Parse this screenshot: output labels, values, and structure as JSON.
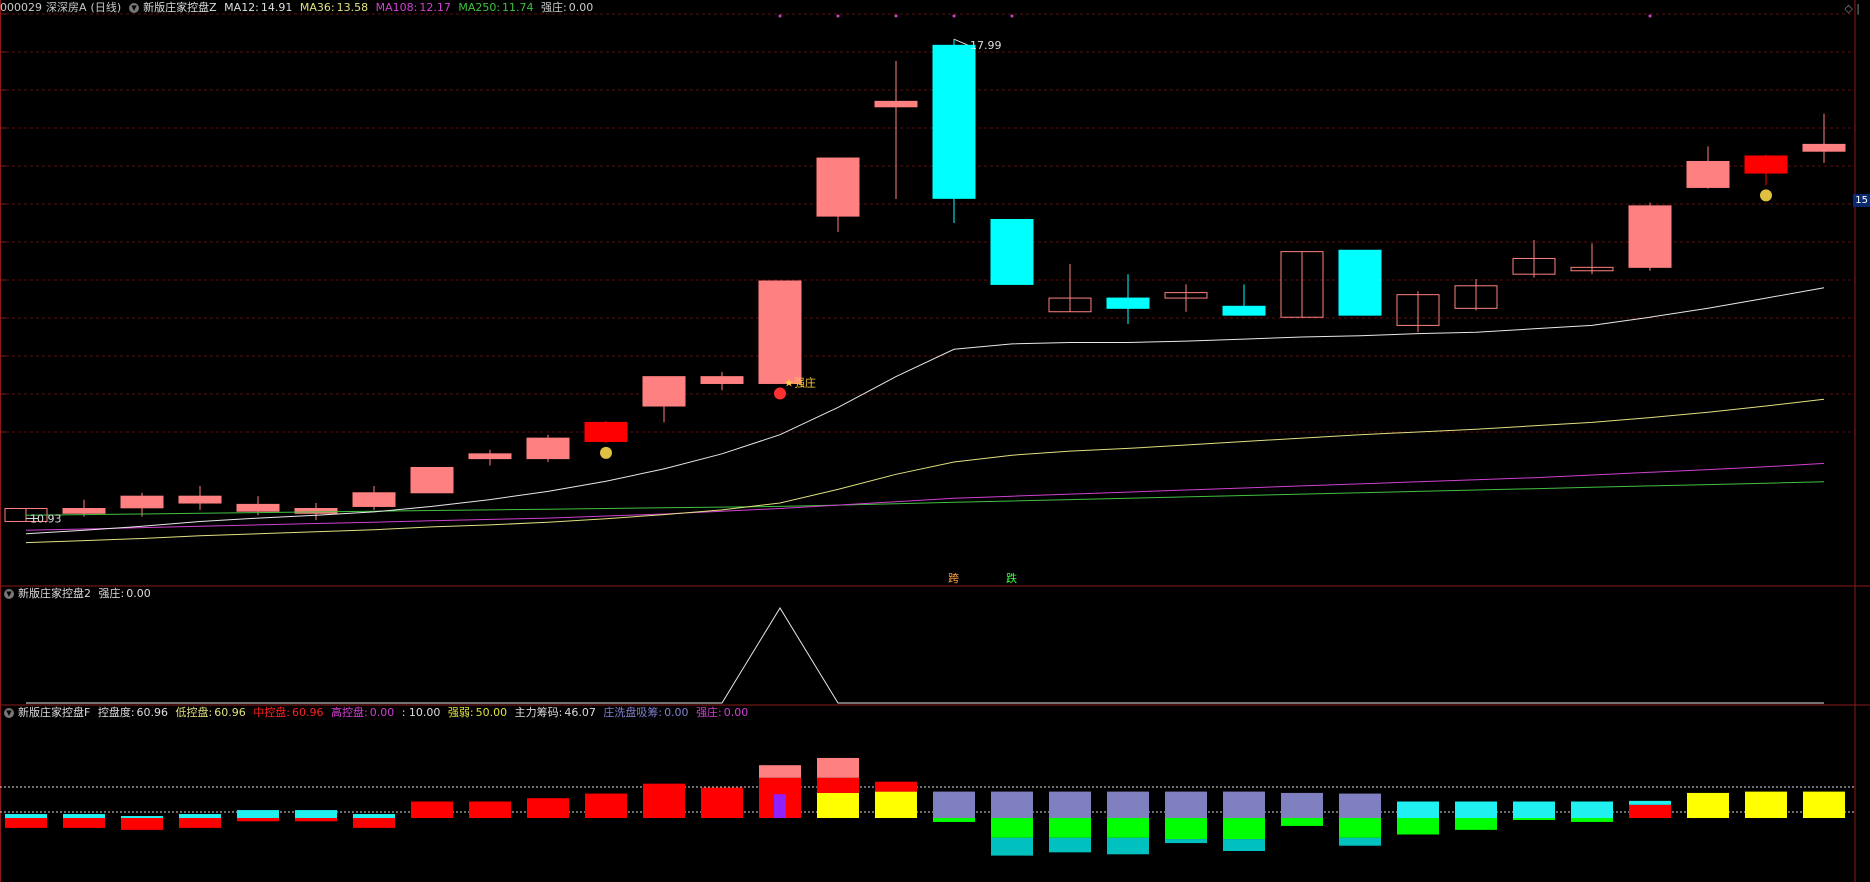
{
  "main_header": {
    "code": "000029",
    "name": "深深房A",
    "period": "(日线)",
    "indicator": "新版庄家控盘Z",
    "ma12_label": "MA12:",
    "ma12": "14.91",
    "ma36_label": "MA36:",
    "ma36": "13.58",
    "ma108_label": "MA108:",
    "ma108": "12.17",
    "ma250_label": "MA250:",
    "ma250": "11.74",
    "qz_label": "强庄:",
    "qz": "0.00"
  },
  "sub1_header": {
    "indicator": "新版庄家控盘2",
    "qz_label": "强庄:",
    "qz": "0.00"
  },
  "sub2_header": {
    "indicator": "新版庄家控盘F",
    "kpd_label": "控盘度:",
    "kpd": "60.96",
    "dkp_label": "低控盘:",
    "dkp": "60.96",
    "zkp_label": "中控盘:",
    "zkp": "60.96",
    "gkp_label": "高控盘:",
    "gkp": "0.00",
    "sep": ": 10.00",
    "qr_label": "强弱:",
    "qr": "50.00",
    "zlcm_label": "主力筹码:",
    "zlcm": "46.07",
    "zxp_label": "庄洗盘吸筹:",
    "zxp": "0.00",
    "qz_label": "强庄:",
    "qz": "0.00"
  },
  "right_price_tag": "15",
  "corner_icon": "diamond-icon",
  "colors": {
    "up": "#ff8080",
    "up_strong": "#ff0000",
    "down": "#00ffff",
    "ma12": "#e8e8e8",
    "ma36": "#e0e080",
    "ma108": "#d040d0",
    "ma250": "#40c040",
    "yellow": "#ffff00",
    "purple": "#8080c0",
    "green": "#00ff00",
    "teal": "#00c0c0"
  },
  "chart_data": {
    "type": "candlestick",
    "price_range": [
      10.0,
      18.3
    ],
    "high_annotation": "17.99",
    "low_annotation": "10.93",
    "markers": [
      {
        "index": 13,
        "text": "强庄"
      },
      {
        "index": 16,
        "text": "跨"
      },
      {
        "index": 17,
        "text": "跌"
      }
    ],
    "candles": [
      {
        "o": 10.93,
        "h": 11.12,
        "l": 10.93,
        "c": 11.12,
        "s": "hollow"
      },
      {
        "o": 11.05,
        "h": 11.25,
        "l": 11.0,
        "c": 11.12,
        "s": "up"
      },
      {
        "o": 11.13,
        "h": 11.35,
        "l": 11.0,
        "c": 11.3,
        "s": "up"
      },
      {
        "o": 11.2,
        "h": 11.45,
        "l": 11.1,
        "c": 11.3,
        "s": "up"
      },
      {
        "o": 11.18,
        "h": 11.3,
        "l": 11.02,
        "c": 11.08,
        "s": "up"
      },
      {
        "o": 11.05,
        "h": 11.2,
        "l": 10.95,
        "c": 11.12,
        "s": "up"
      },
      {
        "o": 11.15,
        "h": 11.45,
        "l": 11.1,
        "c": 11.35,
        "s": "up"
      },
      {
        "o": 11.35,
        "h": 11.72,
        "l": 11.35,
        "c": 11.72,
        "s": "up"
      },
      {
        "o": 11.85,
        "h": 11.98,
        "l": 11.75,
        "c": 11.92,
        "s": "up"
      },
      {
        "o": 11.85,
        "h": 12.2,
        "l": 11.8,
        "c": 12.15,
        "s": "up"
      },
      {
        "o": 12.1,
        "h": 12.4,
        "l": 12.08,
        "c": 12.38,
        "s": "strong"
      },
      {
        "o": 12.62,
        "h": 13.05,
        "l": 12.38,
        "c": 13.05,
        "s": "up"
      },
      {
        "o": 12.95,
        "h": 13.12,
        "l": 12.85,
        "c": 13.05,
        "s": "up"
      },
      {
        "o": 12.95,
        "h": 14.45,
        "l": 12.95,
        "c": 14.45,
        "s": "up"
      },
      {
        "o": 15.4,
        "h": 16.25,
        "l": 15.17,
        "c": 16.25,
        "s": "up"
      },
      {
        "o": 17.0,
        "h": 17.67,
        "l": 15.65,
        "c": 17.08,
        "s": "up"
      },
      {
        "o": 17.9,
        "h": 17.99,
        "l": 15.3,
        "c": 15.66,
        "s": "down"
      },
      {
        "o": 15.35,
        "h": 15.35,
        "l": 14.4,
        "c": 14.4,
        "s": "down"
      },
      {
        "o": 14.2,
        "h": 14.7,
        "l": 14.0,
        "c": 14.0,
        "s": "hollow"
      },
      {
        "o": 14.2,
        "h": 14.55,
        "l": 13.82,
        "c": 14.05,
        "s": "down"
      },
      {
        "o": 14.2,
        "h": 14.4,
        "l": 14.0,
        "c": 14.28,
        "s": "hollow"
      },
      {
        "o": 14.08,
        "h": 14.4,
        "l": 13.95,
        "c": 13.95,
        "s": "down"
      },
      {
        "o": 13.92,
        "h": 14.88,
        "l": 13.92,
        "c": 14.88,
        "s": "hollow"
      },
      {
        "o": 14.9,
        "h": 14.9,
        "l": 13.95,
        "c": 13.95,
        "s": "down"
      },
      {
        "o": 13.8,
        "h": 14.3,
        "l": 13.7,
        "c": 14.25,
        "s": "hollow"
      },
      {
        "o": 14.05,
        "h": 14.48,
        "l": 14.02,
        "c": 14.38,
        "s": "hollow"
      },
      {
        "o": 14.55,
        "h": 15.05,
        "l": 14.5,
        "c": 14.78,
        "s": "hollow"
      },
      {
        "o": 14.6,
        "h": 15.0,
        "l": 14.55,
        "c": 14.65,
        "s": "hollow"
      },
      {
        "o": 14.65,
        "h": 15.6,
        "l": 14.6,
        "c": 15.55,
        "s": "up"
      },
      {
        "o": 15.82,
        "h": 16.42,
        "l": 15.8,
        "c": 16.2,
        "s": "up"
      },
      {
        "o": 16.03,
        "h": 16.3,
        "l": 15.85,
        "c": 16.28,
        "s": "strong"
      },
      {
        "o": 16.35,
        "h": 16.9,
        "l": 16.18,
        "c": 16.45,
        "s": "up"
      }
    ],
    "ma12": [
      10.75,
      10.8,
      10.86,
      10.93,
      10.98,
      11.02,
      11.07,
      11.15,
      11.25,
      11.37,
      11.52,
      11.7,
      11.92,
      12.2,
      12.6,
      13.05,
      13.45,
      13.53,
      13.55,
      13.55,
      13.57,
      13.6,
      13.63,
      13.65,
      13.68,
      13.7,
      13.75,
      13.8,
      13.92,
      14.05,
      14.2,
      14.35
    ],
    "ma36": [
      10.62,
      10.65,
      10.68,
      10.72,
      10.75,
      10.78,
      10.81,
      10.85,
      10.88,
      10.92,
      10.97,
      11.03,
      11.1,
      11.2,
      11.4,
      11.62,
      11.8,
      11.9,
      11.96,
      12.0,
      12.05,
      12.1,
      12.15,
      12.2,
      12.24,
      12.28,
      12.33,
      12.38,
      12.45,
      12.53,
      12.62,
      12.72
    ],
    "ma108": [
      10.8,
      10.82,
      10.84,
      10.86,
      10.88,
      10.9,
      10.92,
      10.94,
      10.96,
      10.98,
      11.01,
      11.04,
      11.08,
      11.12,
      11.17,
      11.22,
      11.27,
      11.3,
      11.33,
      11.36,
      11.39,
      11.42,
      11.45,
      11.48,
      11.51,
      11.54,
      11.57,
      11.61,
      11.65,
      11.69,
      11.73,
      11.78
    ],
    "ma250": [
      11.02,
      11.03,
      11.04,
      11.05,
      11.06,
      11.07,
      11.08,
      11.09,
      11.1,
      11.11,
      11.12,
      11.13,
      11.14,
      11.15,
      11.17,
      11.19,
      11.21,
      11.23,
      11.25,
      11.27,
      11.29,
      11.31,
      11.33,
      11.35,
      11.37,
      11.39,
      11.41,
      11.43,
      11.45,
      11.47,
      11.49,
      11.51
    ],
    "sub1_line": [
      0,
      0,
      0,
      0,
      0,
      0,
      0,
      0,
      0,
      0,
      0,
      0,
      0,
      100,
      0,
      0,
      0,
      0,
      0,
      0,
      0,
      0,
      0,
      0,
      0,
      0,
      0,
      0,
      0,
      0,
      0,
      0
    ],
    "sub2_bars": [
      [
        {
          "b": -15,
          "t": 0,
          "c": "red"
        },
        {
          "b": 0,
          "t": 6,
          "c": "cyan"
        }
      ],
      [
        {
          "b": -15,
          "t": 0,
          "c": "red"
        },
        {
          "b": 0,
          "t": 6,
          "c": "cyan"
        }
      ],
      [
        {
          "b": -18,
          "t": 0,
          "c": "red"
        },
        {
          "b": 0,
          "t": 3,
          "c": "cyan"
        }
      ],
      [
        {
          "b": -15,
          "t": 0,
          "c": "red"
        },
        {
          "b": 0,
          "t": 6,
          "c": "cyan"
        }
      ],
      [
        {
          "b": -5,
          "t": 0,
          "c": "red"
        },
        {
          "b": 0,
          "t": 12,
          "c": "cyan"
        }
      ],
      [
        {
          "b": -5,
          "t": 0,
          "c": "red"
        },
        {
          "b": 0,
          "t": 12,
          "c": "cyan"
        }
      ],
      [
        {
          "b": -15,
          "t": 0,
          "c": "red"
        },
        {
          "b": 0,
          "t": 6,
          "c": "cyan"
        }
      ],
      [
        {
          "b": 0,
          "t": 25,
          "c": "red"
        }
      ],
      [
        {
          "b": 0,
          "t": 25,
          "c": "red"
        }
      ],
      [
        {
          "b": 0,
          "t": 30,
          "c": "red"
        }
      ],
      [
        {
          "b": 0,
          "t": 37,
          "c": "red"
        }
      ],
      [
        {
          "b": 0,
          "t": 52,
          "c": "red"
        }
      ],
      [
        {
          "b": 0,
          "t": 46,
          "c": "red"
        }
      ],
      [
        {
          "b": 0,
          "t": 61,
          "c": "red"
        },
        {
          "b": 61,
          "t": 80,
          "c": "pink"
        },
        {
          "b": 0,
          "t": 36,
          "c": "violet"
        }
      ],
      [
        {
          "b": 0,
          "t": 38,
          "c": "yellow"
        },
        {
          "b": 38,
          "t": 61,
          "c": "red"
        },
        {
          "b": 61,
          "t": 91,
          "c": "pink"
        }
      ],
      [
        {
          "b": 0,
          "t": 40,
          "c": "yellow"
        },
        {
          "b": 40,
          "t": 55,
          "c": "red"
        }
      ],
      [
        {
          "b": 0,
          "t": 40,
          "c": "purple"
        },
        {
          "b": -6,
          "t": 0,
          "c": "green"
        }
      ],
      [
        {
          "b": 0,
          "t": 40,
          "c": "purple"
        },
        {
          "b": -30,
          "t": 0,
          "c": "green"
        },
        {
          "b": -57,
          "t": -30,
          "c": "teal"
        }
      ],
      [
        {
          "b": 0,
          "t": 40,
          "c": "purple"
        },
        {
          "b": -30,
          "t": 0,
          "c": "green"
        },
        {
          "b": -52,
          "t": -30,
          "c": "teal"
        }
      ],
      [
        {
          "b": 0,
          "t": 40,
          "c": "purple"
        },
        {
          "b": -30,
          "t": 0,
          "c": "green"
        },
        {
          "b": -55,
          "t": -30,
          "c": "teal"
        }
      ],
      [
        {
          "b": 0,
          "t": 40,
          "c": "purple"
        },
        {
          "b": -32,
          "t": 0,
          "c": "green"
        },
        {
          "b": -38,
          "t": -32,
          "c": "teal"
        }
      ],
      [
        {
          "b": 0,
          "t": 40,
          "c": "purple"
        },
        {
          "b": -32,
          "t": 0,
          "c": "green"
        },
        {
          "b": -50,
          "t": -32,
          "c": "teal"
        }
      ],
      [
        {
          "b": 0,
          "t": 38,
          "c": "purple"
        },
        {
          "b": -12,
          "t": 0,
          "c": "green"
        }
      ],
      [
        {
          "b": 0,
          "t": 37,
          "c": "purple"
        },
        {
          "b": -30,
          "t": 0,
          "c": "green"
        },
        {
          "b": -42,
          "t": -30,
          "c": "teal"
        }
      ],
      [
        {
          "b": -25,
          "t": 0,
          "c": "green"
        },
        {
          "b": 0,
          "t": 25,
          "c": "cyan"
        }
      ],
      [
        {
          "b": -18,
          "t": 0,
          "c": "green"
        },
        {
          "b": 0,
          "t": 25,
          "c": "cyan"
        }
      ],
      [
        {
          "b": -3,
          "t": 0,
          "c": "green"
        },
        {
          "b": 0,
          "t": 25,
          "c": "cyan"
        }
      ],
      [
        {
          "b": -6,
          "t": 0,
          "c": "green"
        },
        {
          "b": 0,
          "t": 25,
          "c": "cyan"
        }
      ],
      [
        {
          "b": 0,
          "t": 20,
          "c": "red"
        },
        {
          "b": 20,
          "t": 26,
          "c": "cyan"
        }
      ],
      [
        {
          "b": 0,
          "t": 38,
          "c": "yellow"
        }
      ],
      [
        {
          "b": 0,
          "t": 40,
          "c": "yellow"
        }
      ],
      [
        {
          "b": 0,
          "t": 40,
          "c": "yellow"
        }
      ]
    ]
  }
}
